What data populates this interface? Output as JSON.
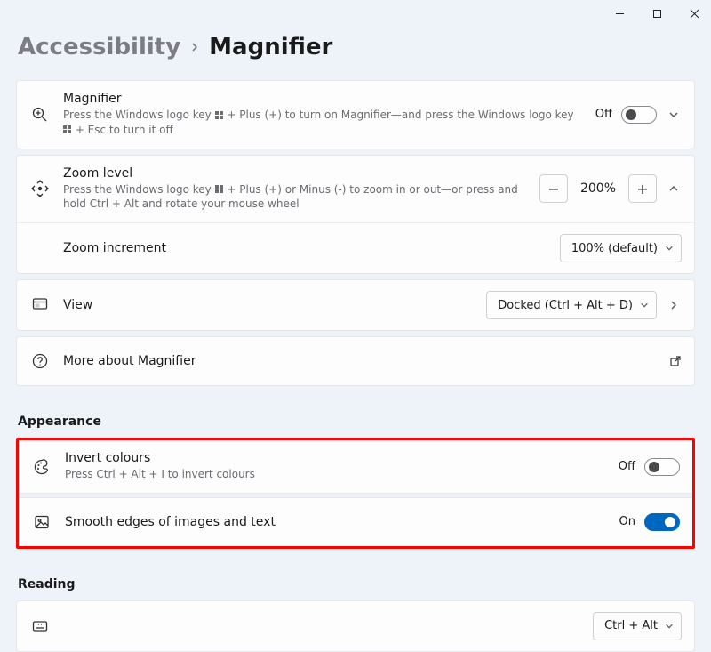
{
  "breadcrumb": {
    "parent": "Accessibility",
    "current": "Magnifier"
  },
  "magnifier": {
    "title": "Magnifier",
    "desc_a": "Press the Windows logo key ",
    "desc_b": " + Plus (+) to turn on Magnifier—and press the Windows logo key ",
    "desc_c": " + Esc to turn it off",
    "state": "Off"
  },
  "zoom": {
    "title": "Zoom level",
    "desc_a": "Press the Windows logo key ",
    "desc_b": " + Plus (+) or Minus (-) to zoom in or out—or press and hold Ctrl + Alt and rotate your mouse wheel",
    "value": "200%"
  },
  "zoom_increment": {
    "title": "Zoom increment",
    "value": "100% (default)"
  },
  "view": {
    "title": "View",
    "value": "Docked (Ctrl + Alt + D)"
  },
  "more": {
    "title": "More about Magnifier"
  },
  "appearance_header": "Appearance",
  "invert": {
    "title": "Invert colours",
    "desc": "Press Ctrl + Alt + I to invert colours",
    "state": "Off"
  },
  "smooth": {
    "title": "Smooth edges of images and text",
    "state": "On"
  },
  "reading_header": "Reading",
  "reading_shortcut": {
    "value": "Ctrl + Alt"
  }
}
